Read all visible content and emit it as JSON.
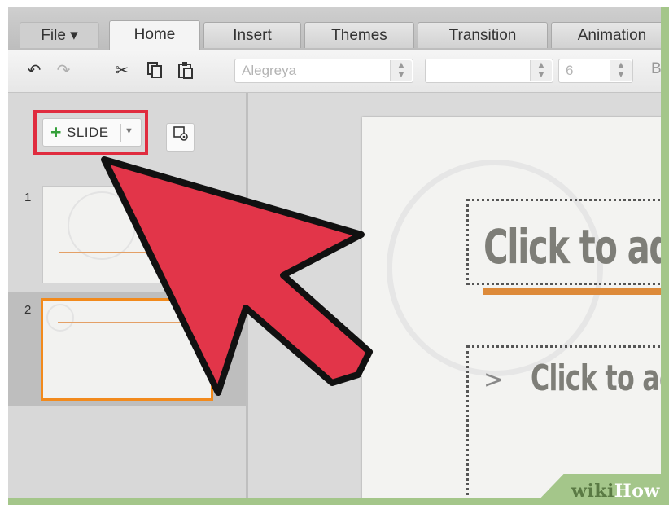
{
  "tabs": [
    {
      "label": "File ▾"
    },
    {
      "label": "Home"
    },
    {
      "label": "Insert"
    },
    {
      "label": "Themes"
    },
    {
      "label": "Transition"
    },
    {
      "label": "Animation"
    }
  ],
  "toolbar": {
    "undo_icon": "undo-icon",
    "redo_icon": "redo-icon",
    "cut_icon": "scissors-icon",
    "copy_icon": "copy-icon",
    "paste_icon": "paste-icon",
    "font_family": "Alegreya",
    "font_size": "6",
    "bold_trunc": "B"
  },
  "left_pane": {
    "add_slide_label": "SLIDE",
    "add_slide_plus": "+",
    "slides": [
      {
        "number": "1"
      },
      {
        "number": "2"
      }
    ]
  },
  "slide_canvas": {
    "title_placeholder": "Click to ado",
    "bullet_marker": ">",
    "body_placeholder": "Click to ad"
  },
  "watermark": {
    "wiki": "wiki",
    "how": "How"
  },
  "colors": {
    "highlight": "#e02c3f",
    "accent": "#dd8a3a",
    "selection": "#f28a1c",
    "plus_green": "#35a03a"
  }
}
